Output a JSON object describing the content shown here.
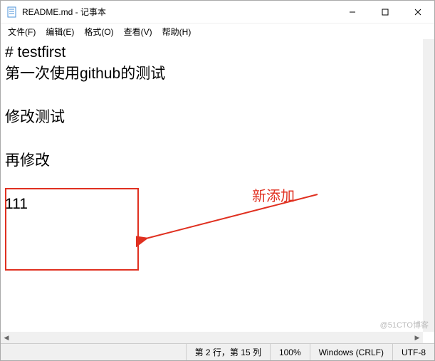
{
  "titlebar": {
    "filename": "README.md - 记事本"
  },
  "menu": {
    "file": "文件(F)",
    "edit": "编辑(E)",
    "format": "格式(O)",
    "view": "查看(V)",
    "help": "帮助(H)"
  },
  "content": {
    "line1": "# testfirst",
    "line2": "第一次使用github的测试",
    "line3": "",
    "line4": "修改测试",
    "line5": "",
    "line6": "再修改",
    "line7": "",
    "line8": "111"
  },
  "annotation": {
    "label": "新添加"
  },
  "statusbar": {
    "position": "第 2 行，第 15 列",
    "zoom": "100%",
    "line_ending": "Windows (CRLF)",
    "encoding": "UTF-8"
  },
  "watermark": "@51CTO博客"
}
